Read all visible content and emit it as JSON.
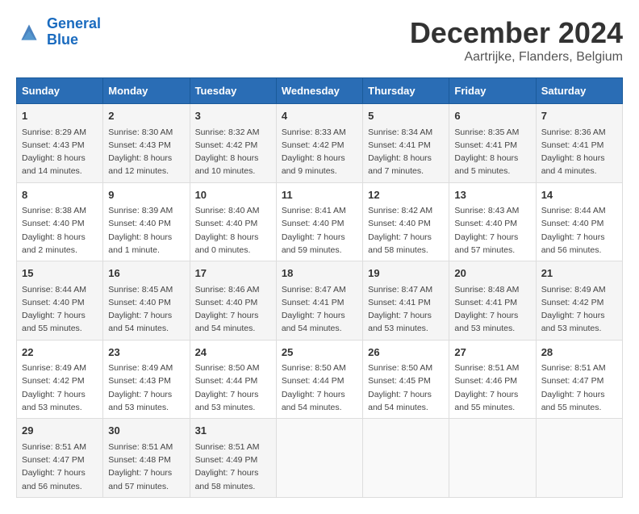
{
  "header": {
    "logo_line1": "General",
    "logo_line2": "Blue",
    "month": "December 2024",
    "location": "Aartrijke, Flanders, Belgium"
  },
  "weekdays": [
    "Sunday",
    "Monday",
    "Tuesday",
    "Wednesday",
    "Thursday",
    "Friday",
    "Saturday"
  ],
  "weeks": [
    [
      {
        "day": "1",
        "sunrise": "Sunrise: 8:29 AM",
        "sunset": "Sunset: 4:43 PM",
        "daylight": "Daylight: 8 hours and 14 minutes."
      },
      {
        "day": "2",
        "sunrise": "Sunrise: 8:30 AM",
        "sunset": "Sunset: 4:43 PM",
        "daylight": "Daylight: 8 hours and 12 minutes."
      },
      {
        "day": "3",
        "sunrise": "Sunrise: 8:32 AM",
        "sunset": "Sunset: 4:42 PM",
        "daylight": "Daylight: 8 hours and 10 minutes."
      },
      {
        "day": "4",
        "sunrise": "Sunrise: 8:33 AM",
        "sunset": "Sunset: 4:42 PM",
        "daylight": "Daylight: 8 hours and 9 minutes."
      },
      {
        "day": "5",
        "sunrise": "Sunrise: 8:34 AM",
        "sunset": "Sunset: 4:41 PM",
        "daylight": "Daylight: 8 hours and 7 minutes."
      },
      {
        "day": "6",
        "sunrise": "Sunrise: 8:35 AM",
        "sunset": "Sunset: 4:41 PM",
        "daylight": "Daylight: 8 hours and 5 minutes."
      },
      {
        "day": "7",
        "sunrise": "Sunrise: 8:36 AM",
        "sunset": "Sunset: 4:41 PM",
        "daylight": "Daylight: 8 hours and 4 minutes."
      }
    ],
    [
      {
        "day": "8",
        "sunrise": "Sunrise: 8:38 AM",
        "sunset": "Sunset: 4:40 PM",
        "daylight": "Daylight: 8 hours and 2 minutes."
      },
      {
        "day": "9",
        "sunrise": "Sunrise: 8:39 AM",
        "sunset": "Sunset: 4:40 PM",
        "daylight": "Daylight: 8 hours and 1 minute."
      },
      {
        "day": "10",
        "sunrise": "Sunrise: 8:40 AM",
        "sunset": "Sunset: 4:40 PM",
        "daylight": "Daylight: 8 hours and 0 minutes."
      },
      {
        "day": "11",
        "sunrise": "Sunrise: 8:41 AM",
        "sunset": "Sunset: 4:40 PM",
        "daylight": "Daylight: 7 hours and 59 minutes."
      },
      {
        "day": "12",
        "sunrise": "Sunrise: 8:42 AM",
        "sunset": "Sunset: 4:40 PM",
        "daylight": "Daylight: 7 hours and 58 minutes."
      },
      {
        "day": "13",
        "sunrise": "Sunrise: 8:43 AM",
        "sunset": "Sunset: 4:40 PM",
        "daylight": "Daylight: 7 hours and 57 minutes."
      },
      {
        "day": "14",
        "sunrise": "Sunrise: 8:44 AM",
        "sunset": "Sunset: 4:40 PM",
        "daylight": "Daylight: 7 hours and 56 minutes."
      }
    ],
    [
      {
        "day": "15",
        "sunrise": "Sunrise: 8:44 AM",
        "sunset": "Sunset: 4:40 PM",
        "daylight": "Daylight: 7 hours and 55 minutes."
      },
      {
        "day": "16",
        "sunrise": "Sunrise: 8:45 AM",
        "sunset": "Sunset: 4:40 PM",
        "daylight": "Daylight: 7 hours and 54 minutes."
      },
      {
        "day": "17",
        "sunrise": "Sunrise: 8:46 AM",
        "sunset": "Sunset: 4:40 PM",
        "daylight": "Daylight: 7 hours and 54 minutes."
      },
      {
        "day": "18",
        "sunrise": "Sunrise: 8:47 AM",
        "sunset": "Sunset: 4:41 PM",
        "daylight": "Daylight: 7 hours and 54 minutes."
      },
      {
        "day": "19",
        "sunrise": "Sunrise: 8:47 AM",
        "sunset": "Sunset: 4:41 PM",
        "daylight": "Daylight: 7 hours and 53 minutes."
      },
      {
        "day": "20",
        "sunrise": "Sunrise: 8:48 AM",
        "sunset": "Sunset: 4:41 PM",
        "daylight": "Daylight: 7 hours and 53 minutes."
      },
      {
        "day": "21",
        "sunrise": "Sunrise: 8:49 AM",
        "sunset": "Sunset: 4:42 PM",
        "daylight": "Daylight: 7 hours and 53 minutes."
      }
    ],
    [
      {
        "day": "22",
        "sunrise": "Sunrise: 8:49 AM",
        "sunset": "Sunset: 4:42 PM",
        "daylight": "Daylight: 7 hours and 53 minutes."
      },
      {
        "day": "23",
        "sunrise": "Sunrise: 8:49 AM",
        "sunset": "Sunset: 4:43 PM",
        "daylight": "Daylight: 7 hours and 53 minutes."
      },
      {
        "day": "24",
        "sunrise": "Sunrise: 8:50 AM",
        "sunset": "Sunset: 4:44 PM",
        "daylight": "Daylight: 7 hours and 53 minutes."
      },
      {
        "day": "25",
        "sunrise": "Sunrise: 8:50 AM",
        "sunset": "Sunset: 4:44 PM",
        "daylight": "Daylight: 7 hours and 54 minutes."
      },
      {
        "day": "26",
        "sunrise": "Sunrise: 8:50 AM",
        "sunset": "Sunset: 4:45 PM",
        "daylight": "Daylight: 7 hours and 54 minutes."
      },
      {
        "day": "27",
        "sunrise": "Sunrise: 8:51 AM",
        "sunset": "Sunset: 4:46 PM",
        "daylight": "Daylight: 7 hours and 55 minutes."
      },
      {
        "day": "28",
        "sunrise": "Sunrise: 8:51 AM",
        "sunset": "Sunset: 4:47 PM",
        "daylight": "Daylight: 7 hours and 55 minutes."
      }
    ],
    [
      {
        "day": "29",
        "sunrise": "Sunrise: 8:51 AM",
        "sunset": "Sunset: 4:47 PM",
        "daylight": "Daylight: 7 hours and 56 minutes."
      },
      {
        "day": "30",
        "sunrise": "Sunrise: 8:51 AM",
        "sunset": "Sunset: 4:48 PM",
        "daylight": "Daylight: 7 hours and 57 minutes."
      },
      {
        "day": "31",
        "sunrise": "Sunrise: 8:51 AM",
        "sunset": "Sunset: 4:49 PM",
        "daylight": "Daylight: 7 hours and 58 minutes."
      },
      null,
      null,
      null,
      null
    ]
  ]
}
